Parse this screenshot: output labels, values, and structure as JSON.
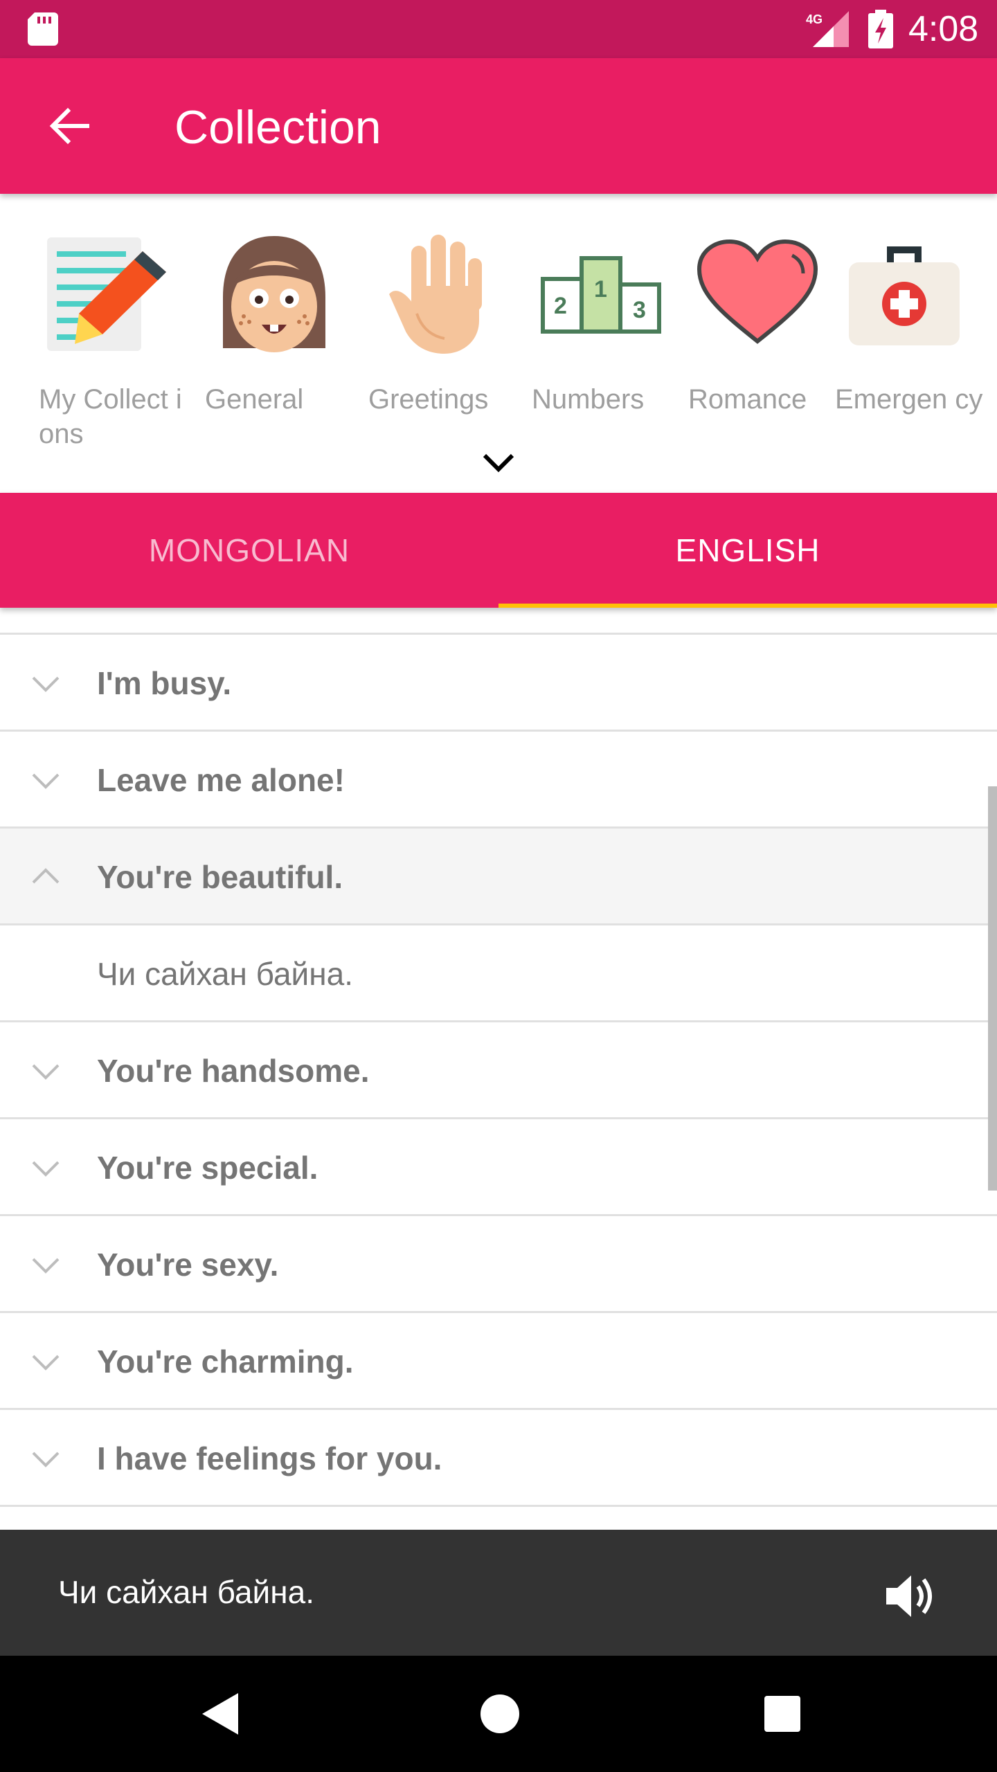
{
  "status_bar": {
    "network": "4G",
    "time": "4:08"
  },
  "app_bar": {
    "title": "Collection"
  },
  "categories": [
    {
      "label": "My Collect ions",
      "icon": "notepad-pencil-icon"
    },
    {
      "label": "General",
      "icon": "girl-face-icon"
    },
    {
      "label": "Greetings",
      "icon": "waving-hand-icon"
    },
    {
      "label": "Numbers",
      "icon": "podium-icon"
    },
    {
      "label": "Romance",
      "icon": "heart-icon"
    },
    {
      "label": "Emergen cy",
      "icon": "first-aid-kit-icon"
    }
  ],
  "tabs": {
    "mongolian": "MONGOLIAN",
    "english": "ENGLISH",
    "selected": "ENGLISH"
  },
  "phrases": [
    {
      "text": "I'm busy."
    },
    {
      "text": "Leave me alone!"
    },
    {
      "text": "You're beautiful.",
      "expanded": true,
      "translation": "Чи сайхан байна."
    },
    {
      "text": "You're handsome."
    },
    {
      "text": "You're special."
    },
    {
      "text": "You're sexy."
    },
    {
      "text": "You're charming."
    },
    {
      "text": "I have feelings for you."
    }
  ],
  "player": {
    "text": "Чи сайхан байна.",
    "icon": "speaker-icon"
  },
  "colors": {
    "primary": "#e91e63",
    "primary_dark": "#c2185b",
    "accent": "#ffc107",
    "player_bg": "#333333"
  }
}
